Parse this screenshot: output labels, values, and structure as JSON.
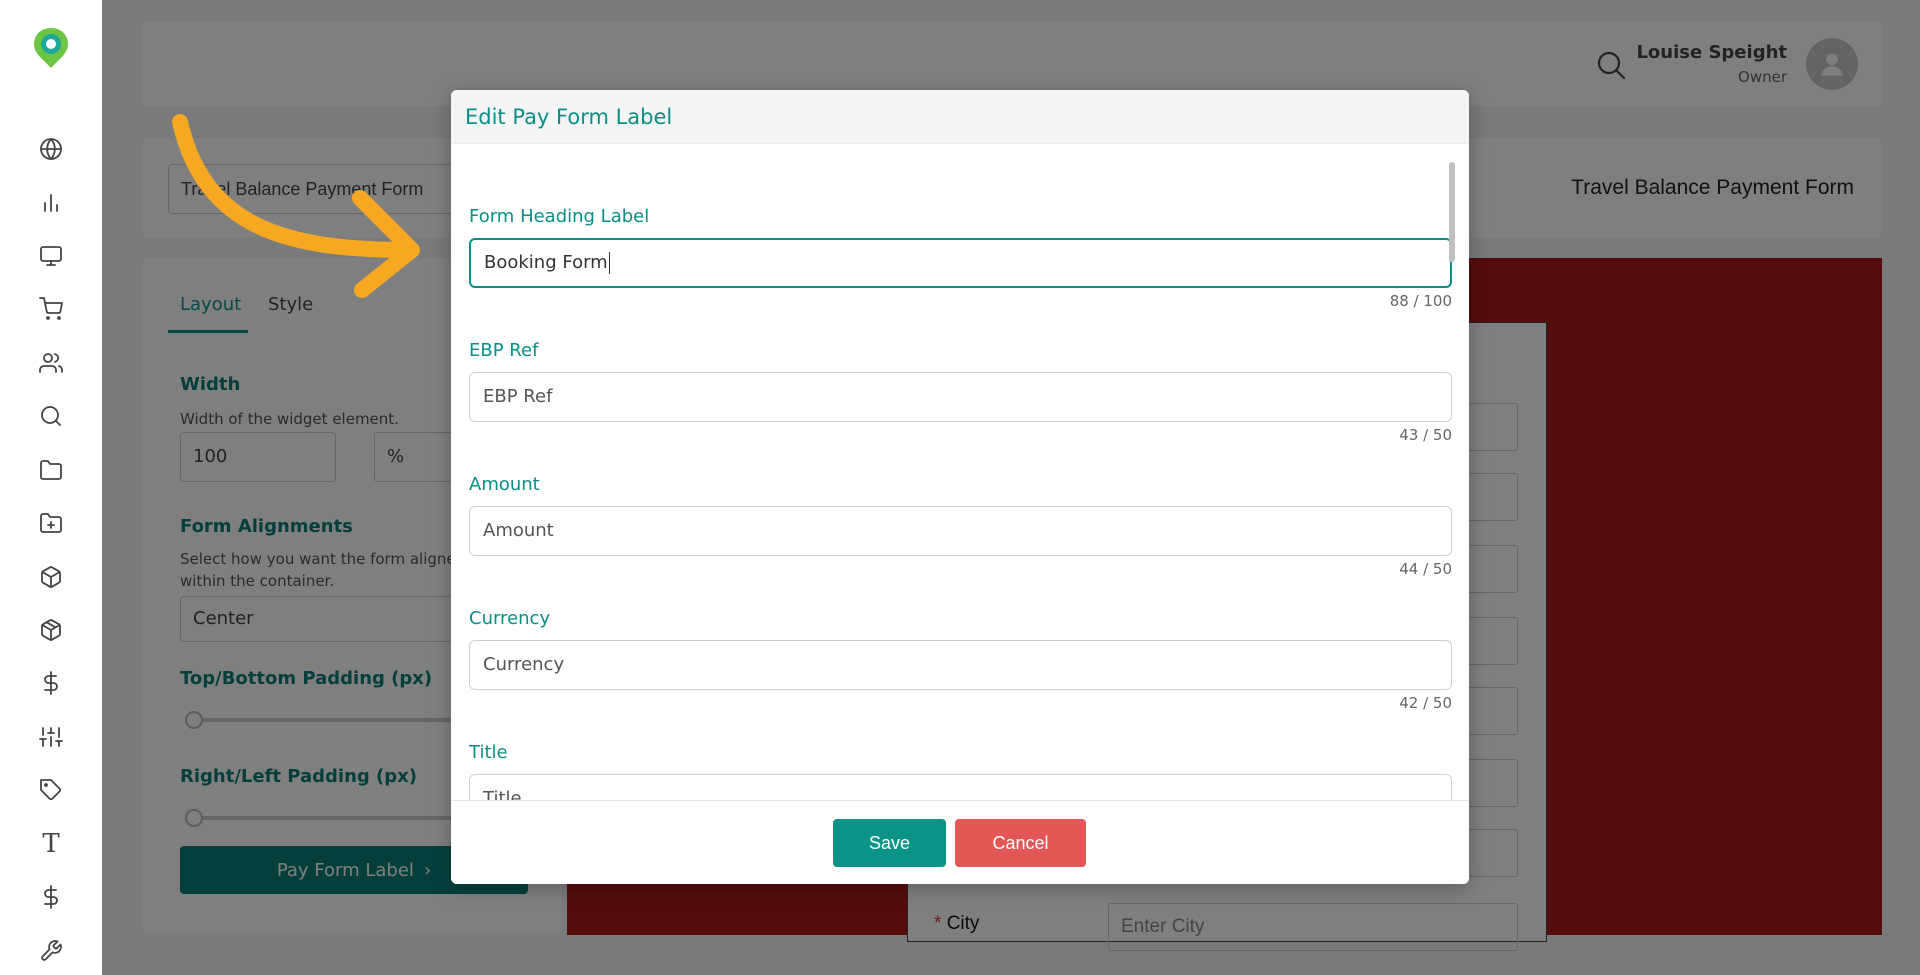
{
  "header": {
    "user_name": "Louise Speight",
    "user_role": "Owner"
  },
  "form_bar": {
    "form_name_value": "Travel Balance Payment Form",
    "form_title_display": "Travel Balance Payment Form"
  },
  "left_panel": {
    "tabs": [
      {
        "label": "Layout",
        "active": true
      },
      {
        "label": "Style",
        "active": false
      }
    ],
    "width": {
      "heading": "Width",
      "description": "Width of the widget element.",
      "value": "100",
      "unit": "%"
    },
    "alignment": {
      "heading": "Form Alignments",
      "description": "Select how you want the form aligned within the container.",
      "value": "Center"
    },
    "top_bottom_padding": {
      "heading": "Top/Bottom Padding (px)",
      "value": 0
    },
    "right_left_padding": {
      "heading": "Right/Left Padding (px)",
      "value": 0
    },
    "pay_form_label_button": "Pay Form Label",
    "chevron_glyph": "›"
  },
  "preview": {
    "city_required_mark": "*",
    "city_label": "City",
    "city_placeholder": "Enter City"
  },
  "modal": {
    "title": "Edit Pay Form Label",
    "fields": [
      {
        "label": "Form Heading Label",
        "value": "Booking Form",
        "counter": "88 / 100",
        "active": true
      },
      {
        "label": "EBP Ref",
        "value": "EBP Ref",
        "counter": "43 / 50"
      },
      {
        "label": "Amount",
        "value": "Amount",
        "counter": "44 / 50"
      },
      {
        "label": "Currency",
        "value": "Currency",
        "counter": "42 / 50"
      },
      {
        "label": "Title",
        "value": "Title"
      }
    ],
    "save_label": "Save",
    "cancel_label": "Cancel"
  },
  "colors": {
    "accent": "#0a9488",
    "cancel": "#e45757",
    "preview_background": "#a81a1a",
    "arrow": "#f7a823"
  },
  "sidebar_icons": [
    "globe-icon",
    "bar-chart-icon",
    "monitor-icon",
    "cart-icon",
    "users-icon",
    "search-icon",
    "folder-icon",
    "folder-plus-icon",
    "box-icon",
    "package-icon",
    "dollar-icon",
    "sliders-icon",
    "tag-icon",
    "text-icon",
    "dollar-icon",
    "wrench-icon"
  ]
}
